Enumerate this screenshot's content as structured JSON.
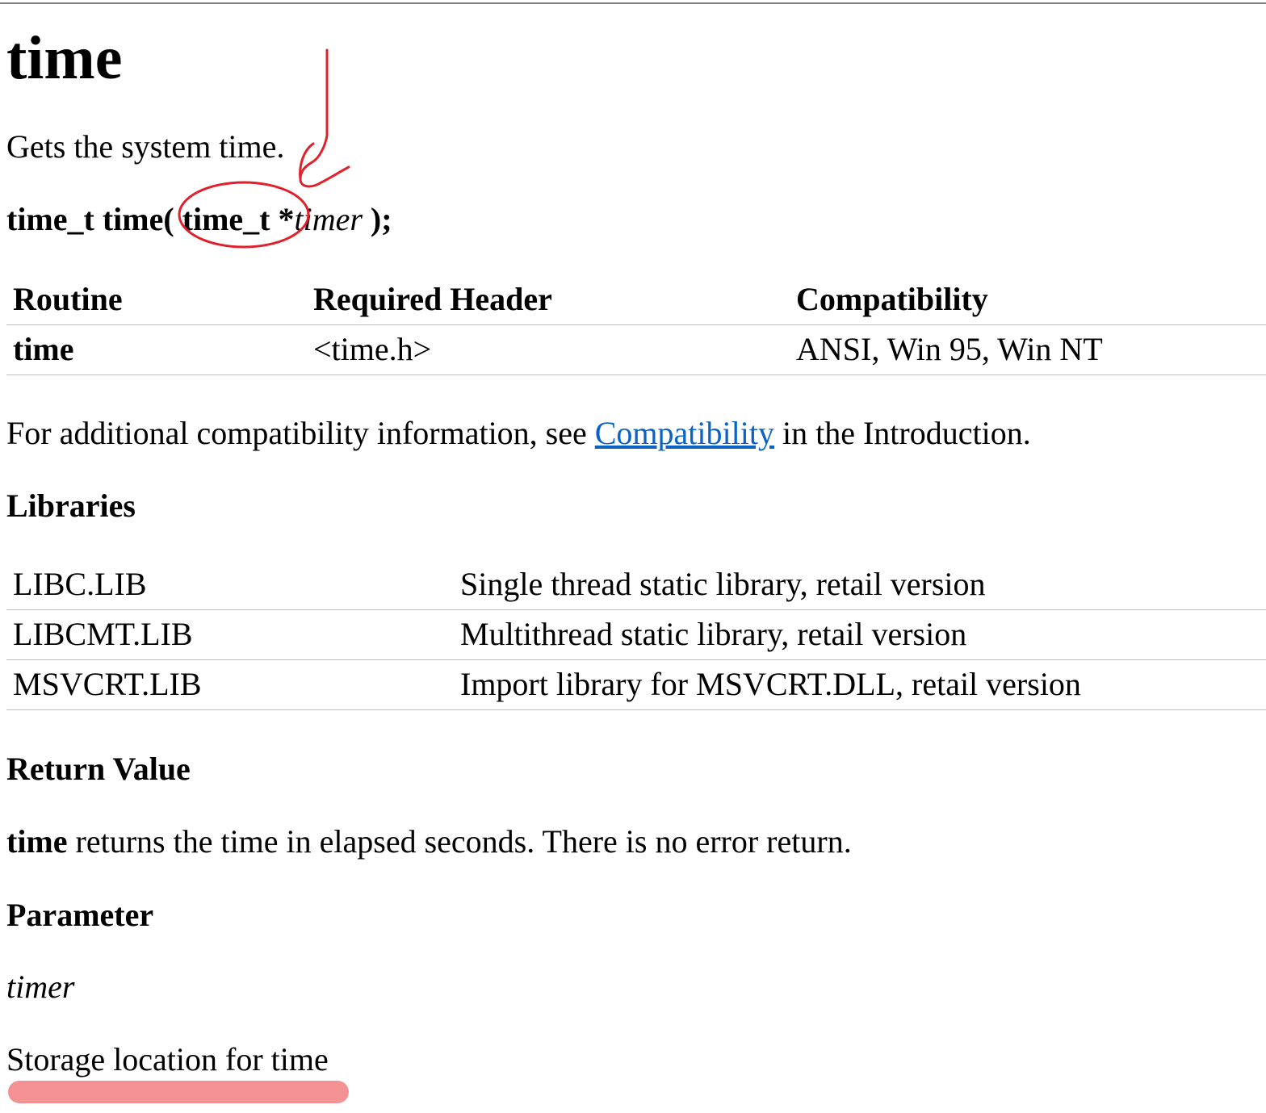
{
  "page": {
    "title": "time",
    "description": "Gets the system time.",
    "syntax": {
      "prefix": "time_t time(",
      "param_type": " time_t *",
      "param_name": "timer",
      "suffix": " );"
    }
  },
  "compat_table": {
    "headers": [
      "Routine",
      "Required Header",
      "Compatibility"
    ],
    "rows": [
      {
        "routine": "time",
        "header": "<time.h>",
        "compatibility": "ANSI, Win 95, Win NT"
      }
    ]
  },
  "compat_note": {
    "before": "For additional compatibility information, see ",
    "link_text": "Compatibility",
    "after": " in the Introduction.",
    "link_color": "#0b62c4"
  },
  "libraries": {
    "heading": "Libraries",
    "rows": [
      {
        "name": "LIBC.LIB",
        "desc": "Single thread static library, retail version"
      },
      {
        "name": "LIBCMT.LIB",
        "desc": "Multithread static library, retail version"
      },
      {
        "name": "MSVCRT.LIB",
        "desc": "Import library for MSVCRT.DLL, retail version"
      }
    ]
  },
  "return_value": {
    "heading": "Return Value",
    "func": "time",
    "text": " returns the time in elapsed seconds. There is no error return."
  },
  "parameter": {
    "heading": "Parameter",
    "name": "timer",
    "desc": "Storage location for time"
  },
  "annotations": {
    "pen_color": "#e0202a",
    "highlight_color": "#f28b8e"
  }
}
